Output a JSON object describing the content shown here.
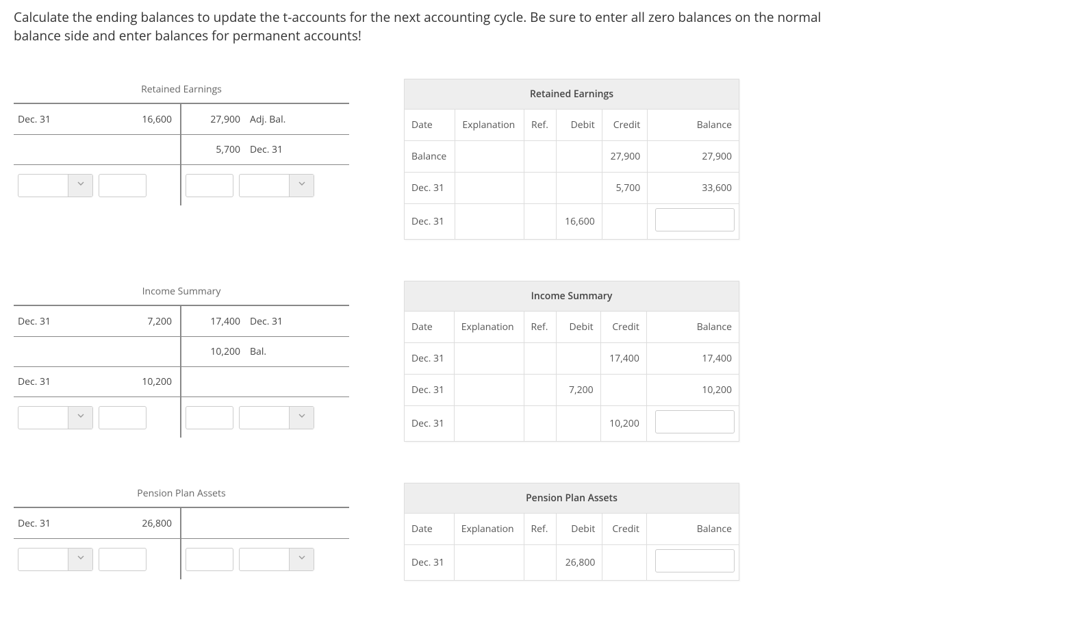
{
  "instructions": "Calculate the ending balances to update the t-accounts for the next accounting cycle. Be sure to enter all zero balances on the normal balance side and enter balances for permanent accounts!",
  "headers": {
    "date": "Date",
    "explanation": "Explanation",
    "ref": "Ref.",
    "debit": "Debit",
    "credit": "Credit",
    "balance": "Balance"
  },
  "accounts": [
    {
      "name": "Retained Earnings",
      "t": {
        "rows": [
          {
            "left_date": "Dec. 31",
            "left_amount": "16,600",
            "right_amount": "27,900",
            "right_label": "Adj. Bal."
          },
          {
            "left_date": "",
            "left_amount": "",
            "right_amount": "5,700",
            "right_label": "Dec. 31"
          }
        ]
      },
      "ledger": [
        {
          "date": "Balance",
          "expl": "",
          "ref": "",
          "debit": "",
          "credit": "27,900",
          "balance": "27,900",
          "balance_input": false
        },
        {
          "date": "Dec. 31",
          "expl": "",
          "ref": "",
          "debit": "",
          "credit": "5,700",
          "balance": "33,600",
          "balance_input": false
        },
        {
          "date": "Dec. 31",
          "expl": "",
          "ref": "",
          "debit": "16,600",
          "credit": "",
          "balance": "",
          "balance_input": true
        }
      ]
    },
    {
      "name": "Income Summary",
      "t": {
        "rows": [
          {
            "left_date": "Dec. 31",
            "left_amount": "7,200",
            "right_amount": "17,400",
            "right_label": "Dec. 31"
          },
          {
            "left_date": "",
            "left_amount": "",
            "right_amount": "10,200",
            "right_label": "Bal."
          },
          {
            "left_date": "Dec. 31",
            "left_amount": "10,200",
            "right_amount": "",
            "right_label": ""
          }
        ]
      },
      "ledger": [
        {
          "date": "Dec. 31",
          "expl": "",
          "ref": "",
          "debit": "",
          "credit": "17,400",
          "balance": "17,400",
          "balance_input": false
        },
        {
          "date": "Dec. 31",
          "expl": "",
          "ref": "",
          "debit": "7,200",
          "credit": "",
          "balance": "10,200",
          "balance_input": false
        },
        {
          "date": "Dec. 31",
          "expl": "",
          "ref": "",
          "debit": "",
          "credit": "10,200",
          "balance": "",
          "balance_input": true
        }
      ]
    },
    {
      "name": "Pension Plan Assets",
      "t": {
        "rows": [
          {
            "left_date": "Dec. 31",
            "left_amount": "26,800",
            "right_amount": "",
            "right_label": ""
          }
        ]
      },
      "ledger": [
        {
          "date": "Dec. 31",
          "expl": "",
          "ref": "",
          "debit": "26,800",
          "credit": "",
          "balance": "",
          "balance_input": true
        }
      ]
    }
  ]
}
